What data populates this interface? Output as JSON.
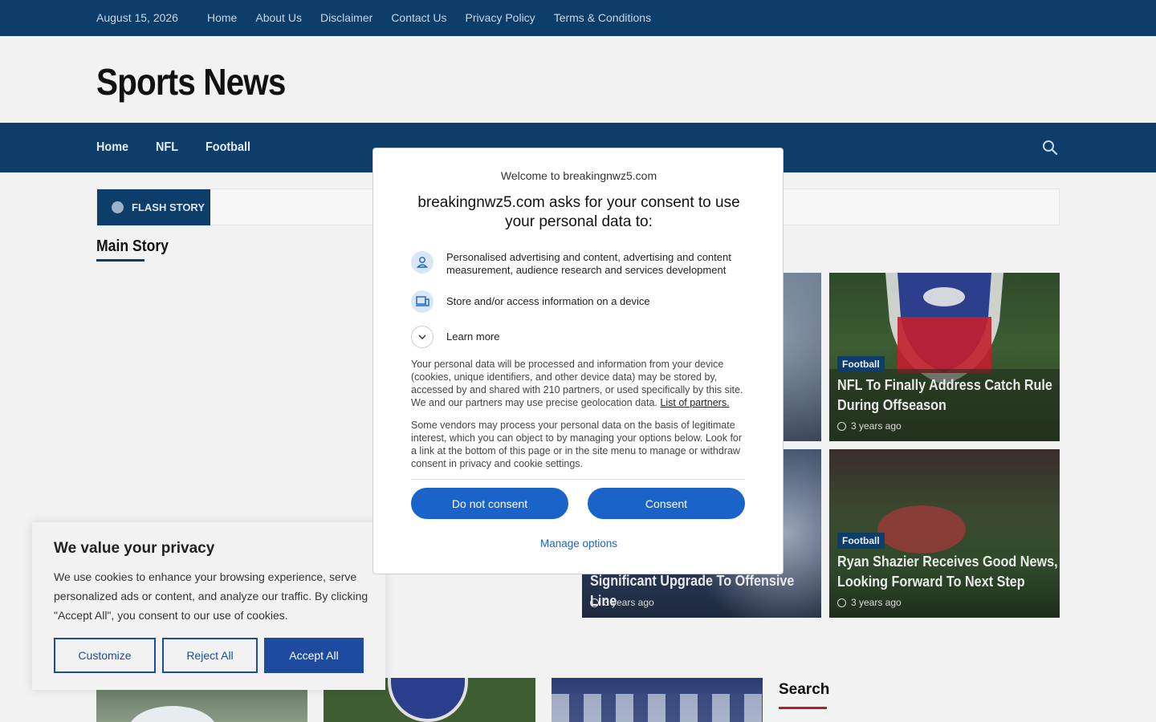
{
  "topbar": {
    "date": "August 15, 2026",
    "nav": [
      "Home",
      "About Us",
      "Disclaimer",
      "Contact Us",
      "Privacy Policy",
      "Terms & Conditions"
    ]
  },
  "site": {
    "title": "Sports News"
  },
  "mainnav": {
    "items": [
      "Home",
      "NFL",
      "Football"
    ]
  },
  "flash": {
    "label": "FLASH STORY"
  },
  "sections": {
    "main_story": "Main Story",
    "search": "Search"
  },
  "cards": [
    {
      "category": "Football",
      "title": "NFL To Finally Address Catch Rule During Offseason",
      "time": "3 years ago"
    },
    {
      "category": "Football",
      "title": "Ryan Shazier Receives Good News, Looking Forward To Next Step",
      "time": "3 years ago"
    },
    {
      "title": "Significant Upgrade To Offensive Line",
      "time": "3 years ago"
    }
  ],
  "privacy": {
    "title": "We value your privacy",
    "text": "We use cookies to enhance your browsing experience, serve personalized ads or content, and analyze our traffic. By clicking \"Accept All\", you consent to our use of cookies.",
    "customize": "Customize",
    "reject": "Reject All",
    "accept": "Accept All"
  },
  "consent": {
    "welcome": "Welcome to breakingnwz5.com",
    "headline": "breakingnwz5.com asks for your consent to use your personal data to:",
    "purposes": [
      "Personalised advertising and content, advertising and content measurement, audience research and services development",
      "Store and/or access information on a device"
    ],
    "learn_more": "Learn more",
    "body1": "Your personal data will be processed and information from your device (cookies, unique identifiers, and other device data) may be stored by, accessed by and shared with 210 partners, or used specifically by this site. We and our partners may use precise geolocation data.",
    "partners_link": "List of partners.",
    "body2": "Some vendors may process your personal data on the basis of legitimate interest, which you can object to by managing your options below. Look for a link at the bottom of this page or in the site menu to manage or withdraw consent in privacy and cookie settings.",
    "do_not_consent": "Do not consent",
    "consent": "Consent",
    "manage": "Manage options"
  }
}
